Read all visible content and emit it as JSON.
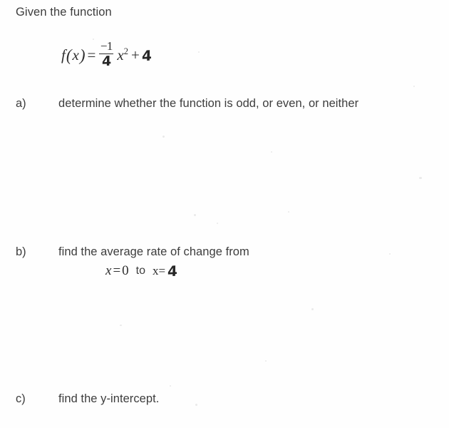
{
  "document": {
    "prompt": "Given the function",
    "formula": {
      "lhs_f": "f",
      "lhs_open": "(",
      "lhs_var": "x",
      "lhs_close": ")",
      "equals": "=",
      "fraction_numerator": "−1",
      "fraction_denominator": "4",
      "variable": "x",
      "exponent": "2",
      "plus": "+",
      "constant": "4"
    },
    "questions": [
      {
        "label": "a)",
        "text": "determine whether the function is odd, or even, or neither"
      },
      {
        "label": "b)",
        "text": "find the average rate of change from"
      },
      {
        "label": "c)",
        "text": "find the y-intercept."
      }
    ],
    "interval": {
      "start_var": "x",
      "start_equals": "=",
      "start_value": "0",
      "connector": "to",
      "end_var": "x=",
      "end_value": "4"
    }
  },
  "style": {
    "ink_color": "#3d3d3d",
    "math_color": "#2f2f2f",
    "paper_color": "#fefefe"
  }
}
